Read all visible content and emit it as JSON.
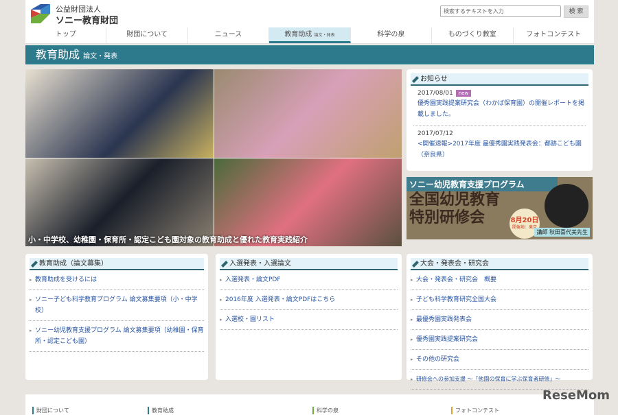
{
  "header": {
    "org_type": "公益財団法人",
    "org_name": "ソニー教育財団",
    "search_placeholder": "検索するテキストを入力",
    "search_button": "検 索"
  },
  "nav": [
    {
      "label": "トップ"
    },
    {
      "label": "財団について"
    },
    {
      "label": "ニュース"
    },
    {
      "label": "教育助成",
      "sub": "論文・発表"
    },
    {
      "label": "科学の泉"
    },
    {
      "label": "ものづくり教室"
    },
    {
      "label": "フォトコンテスト"
    }
  ],
  "banner": {
    "title": "教育助成",
    "sub": "論文・発表"
  },
  "hero": {
    "caption": "小・中学校、幼稚園・保育所・認定こども園対象の教育助成と優れた教育実践紹介"
  },
  "news": {
    "title": "お知らせ",
    "items": [
      {
        "date": "2017/08/01",
        "badge": "new",
        "text": "優秀園実践提案研究会（わかば保育園）の開催レポートを掲載しました。"
      },
      {
        "date": "2017/07/12",
        "text": "<開催速報>2017年度 最優秀園実践発表会：都跡こども園（奈良県）"
      }
    ]
  },
  "ad": {
    "line1": "ソニー幼児教育支援プログラム",
    "line2": "全国幼児教育",
    "line3": "特別研修会",
    "date": "8月20日",
    "place": "開催地：東京",
    "lecturer": "講師 秋田喜代美先生"
  },
  "cards": [
    {
      "title": "教育助成（論文募集）",
      "items": [
        "教育助成を受けるには",
        "ソニー子ども科学教育プログラム 論文募集要項（小・中学校）",
        "ソニー幼児教育支援プログラム 論文募集要項（幼稚園・保育所・認定こども園）"
      ]
    },
    {
      "title": "入選発表・入選論文",
      "items": [
        "入選発表・論文PDF",
        "2016年度 入選発表・論文PDFはこちら",
        "入選校・園リスト"
      ]
    },
    {
      "title": "大会・発表会・研究会",
      "items": [
        "大会・発表会・研究会　概要",
        "子ども科学教育研究全国大会",
        "最優秀園実践発表会",
        "優秀園実践提案研究会",
        "その他の研究会",
        "研修会への参加支援 ～「他園の保育に学ぶ保育者研修」～"
      ]
    }
  ],
  "footer": [
    "財団について",
    "教育助成",
    "科学の泉",
    "フォトコンテスト"
  ],
  "watermark": "ReseMom"
}
